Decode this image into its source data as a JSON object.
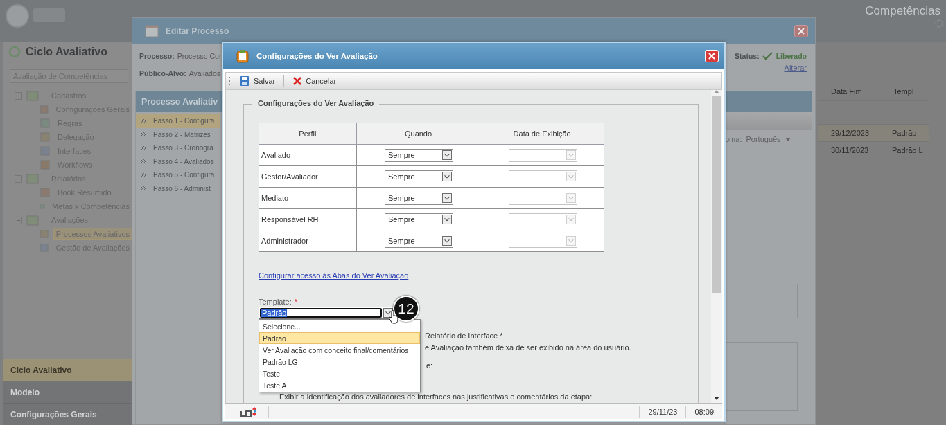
{
  "app": {
    "title": "Competências",
    "module_title": "Ciclo Avaliativo",
    "module_select": "Avaliação de Competências",
    "tree": [
      {
        "label": "Cadastros",
        "expanded": true,
        "children": [
          {
            "label": "Configurações Gerais",
            "selected": false
          },
          {
            "label": "Regras",
            "selected": false
          },
          {
            "label": "Delegação",
            "selected": false
          },
          {
            "label": "Interfaces",
            "selected": false
          },
          {
            "label": "Workflows",
            "selected": false
          }
        ]
      },
      {
        "label": "Relatórios",
        "expanded": true,
        "children": [
          {
            "label": "Book Resumido",
            "selected": false
          },
          {
            "label": "Metas x Competências",
            "selected": false
          }
        ]
      },
      {
        "label": "Avaliações",
        "expanded": true,
        "children": [
          {
            "label": "Processos Avaliativos",
            "selected": true
          },
          {
            "label": "Gestão de Avaliações",
            "selected": false
          }
        ]
      }
    ],
    "accordion": [
      {
        "label": "Ciclo Avaliativo",
        "selected": true
      },
      {
        "label": "Modelo",
        "selected": false
      },
      {
        "label": "Configurações Gerais",
        "selected": false
      }
    ],
    "grid": {
      "columns": [
        "Data Fim",
        "Templ"
      ],
      "rows": [
        [
          "29/12/2023",
          "Padrão"
        ],
        [
          "30/11/2023",
          "Padrão L"
        ]
      ]
    }
  },
  "edit_window": {
    "title": "Editar Processo",
    "process_label": "Processo:",
    "process_value": "Processo Con",
    "audience_label": "Público-Alvo:",
    "audience_value": "Avaliados",
    "status_label": "Status:",
    "status_value": "Liberado",
    "change_link": "Alterar",
    "steps_title": "Processo Avaliativ",
    "steps": [
      {
        "label": "Passo 1 - Configura",
        "selected": true
      },
      {
        "label": "Passo 2 - Matrizes",
        "selected": false
      },
      {
        "label": "Passo 3 - Cronogra",
        "selected": false
      },
      {
        "label": "Passo 4 - Avaliados",
        "selected": false
      },
      {
        "label": "Passo 5 - Configura",
        "selected": false
      },
      {
        "label": "Passo 6 - Administ",
        "selected": false
      }
    ],
    "language_label": "oma:",
    "language_value": "Português"
  },
  "dialog": {
    "title": "Configurações do Ver Avaliação",
    "toolbar": [
      {
        "kind": "save",
        "label": "Salvar"
      },
      {
        "kind": "cancel",
        "label": "Cancelar"
      }
    ],
    "fieldset_title": "Configurações do Ver Avaliação",
    "table": {
      "columns": [
        "Perfil",
        "Quando",
        "Data de Exibição"
      ],
      "rows": [
        {
          "profile": "Avaliado",
          "when": "Sempre",
          "date_disabled": true
        },
        {
          "profile": "Gestor/Avaliador",
          "when": "Sempre",
          "date_disabled": true
        },
        {
          "profile": "Mediato",
          "when": "Sempre",
          "date_disabled": true
        },
        {
          "profile": "Responsável RH",
          "when": "Sempre",
          "date_disabled": true
        },
        {
          "profile": "Administrador",
          "when": "Sempre",
          "date_disabled": true
        }
      ]
    },
    "link": "Configurar acesso às Abas do Ver Avaliação",
    "template": {
      "label": "Template:",
      "required_mark": "*",
      "value": "Padrão",
      "options": [
        {
          "label": "Selecione...",
          "selected": false
        },
        {
          "label": "Padrão",
          "selected": true
        },
        {
          "label": "Ver Avaliação com conceito final/comentários",
          "selected": false
        },
        {
          "label": "Padrão LG",
          "selected": false
        },
        {
          "label": "Teste",
          "selected": false
        },
        {
          "label": "Teste A",
          "selected": false
        }
      ]
    },
    "hidden_texts": [
      "Relatório de Interface *",
      "e Avaliação também deixa de ser exibido na área do usuário.",
      "e:",
      "Exibir a identificação dos avaliadores de interfaces nas justificativas e comentários da etapa:"
    ],
    "status_bar": {
      "date": "29/11/23",
      "time": "08:09"
    },
    "step_badge": "12"
  }
}
